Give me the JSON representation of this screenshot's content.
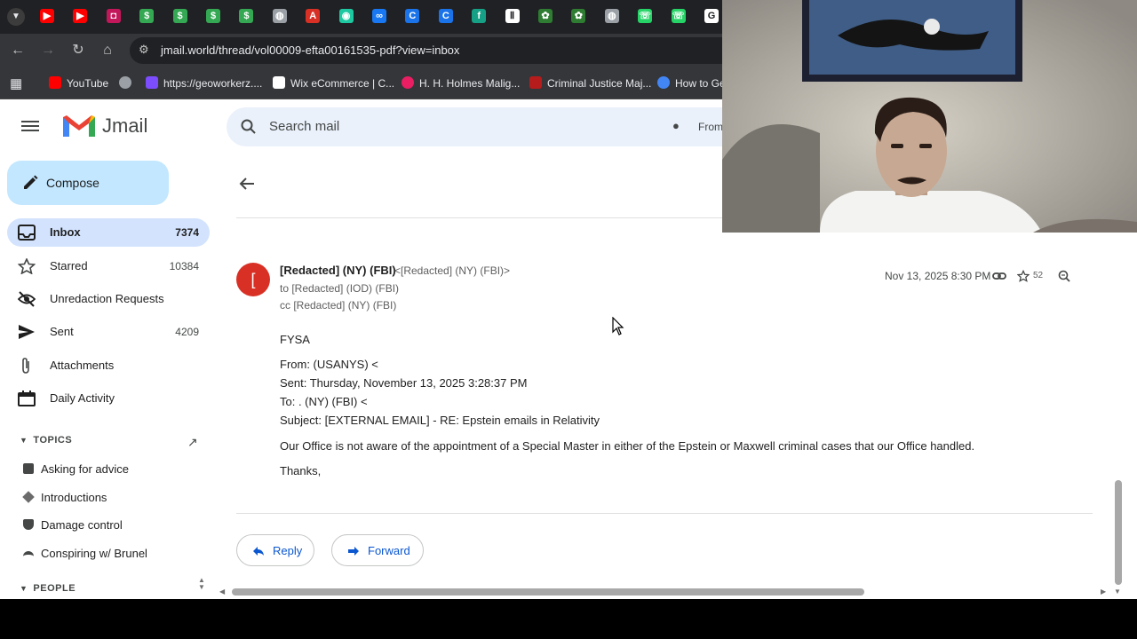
{
  "browser": {
    "url": "jmail.world/thread/vol00009-efta00161535-pdf?view=inbox",
    "tab_icons": [
      {
        "name": "youtube-tab-icon",
        "color": "#ff0000",
        "glyph": "▶"
      },
      {
        "name": "youtube-tab-icon",
        "color": "#ff0000",
        "glyph": "▶"
      },
      {
        "name": "bookmark-tab-icon",
        "color": "#c2185b",
        "glyph": "◘"
      },
      {
        "name": "dollar-tab-icon",
        "color": "#34a853",
        "glyph": "$"
      },
      {
        "name": "dollar-tab-icon",
        "color": "#34a853",
        "glyph": "$"
      },
      {
        "name": "dollar-tab-icon",
        "color": "#34a853",
        "glyph": "$"
      },
      {
        "name": "dollar-tab-icon",
        "color": "#34a853",
        "glyph": "$"
      },
      {
        "name": "globe-tab-icon",
        "color": "#9aa0a6",
        "glyph": "◍"
      },
      {
        "name": "pdf-tab-icon",
        "color": "#d93025",
        "glyph": "A"
      },
      {
        "name": "chat-tab-icon",
        "color": "#1ec8a0",
        "glyph": "◉"
      },
      {
        "name": "meta-tab-icon",
        "color": "#1877f2",
        "glyph": "∞"
      },
      {
        "name": "c-tab-icon",
        "color": "#1a73e8",
        "glyph": "C"
      },
      {
        "name": "c-tab-icon",
        "color": "#1a73e8",
        "glyph": "C"
      },
      {
        "name": "f-tab-icon",
        "color": "#16a085",
        "glyph": "f"
      },
      {
        "name": "active-tab-icon",
        "color": "#ffffff",
        "glyph": "Ⅱ"
      },
      {
        "name": "cactus-tab-icon",
        "color": "#2e7d32",
        "glyph": "✿"
      },
      {
        "name": "cactus-tab-icon",
        "color": "#2e7d32",
        "glyph": "✿"
      },
      {
        "name": "globe-tab-icon",
        "color": "#9aa0a6",
        "glyph": "◍"
      },
      {
        "name": "whatsapp-tab-icon",
        "color": "#25d366",
        "glyph": "☏"
      },
      {
        "name": "whatsapp-tab-icon",
        "color": "#25d366",
        "glyph": "☏"
      },
      {
        "name": "google-tab-icon",
        "color": "#ffffff",
        "glyph": "G"
      }
    ],
    "bookmarks": [
      {
        "label": "YouTube",
        "color": "#ff0000"
      },
      {
        "label": "https://geoworkerz....",
        "color": "#9aa0a6"
      },
      {
        "label": "https://geoworkerz....",
        "color": "#7c4dff"
      },
      {
        "label": "Wix eCommerce | C...",
        "color": "#ffffff"
      },
      {
        "label": "H. H. Holmes Malig...",
        "color": "#e91e63"
      },
      {
        "label": "Criminal Justice Maj...",
        "color": "#b71c1c"
      },
      {
        "label": "How to Ge",
        "color": "#4285f4"
      }
    ]
  },
  "app": {
    "name": "Jmail",
    "search_placeholder": "Search mail",
    "search_filter_label": "From"
  },
  "sidebar": {
    "compose_label": "Compose",
    "items": [
      {
        "label": "Inbox",
        "count": "7374",
        "icon": "inbox-icon",
        "active": true
      },
      {
        "label": "Starred",
        "count": "10384",
        "icon": "star-icon"
      },
      {
        "label": "Unredaction Requests",
        "count": "",
        "icon": "eye-off-icon"
      },
      {
        "label": "Sent",
        "count": "4209",
        "icon": "send-icon"
      },
      {
        "label": "Attachments",
        "count": "",
        "icon": "paperclip-icon"
      },
      {
        "label": "Daily Activity",
        "count": "",
        "icon": "calendar-icon"
      }
    ],
    "topics_header": "TOPICS",
    "topics": [
      {
        "label": "Asking for advice",
        "icon": "chat-bubble-icon"
      },
      {
        "label": "Introductions",
        "icon": "handshake-icon"
      },
      {
        "label": "Damage control",
        "icon": "shield-icon"
      },
      {
        "label": "Conspiring w/ Brunel",
        "icon": "spy-icon"
      }
    ],
    "people_header": "PEOPLE"
  },
  "message": {
    "avatar_letter": "[",
    "sender_name": "[Redacted] (NY) (FBI)",
    "sender_email": "<[Redacted] (NY) (FBI)>",
    "to_line": "to [Redacted] (IOD) (FBI)",
    "cc_line": "cc [Redacted] (NY) (FBI)",
    "date": "Nov 13, 2025 8:30 PM",
    "star_count": "52",
    "body": {
      "greeting": "FYSA",
      "from": "From: (USANYS) <",
      "sent": "Sent: Thursday, November 13, 2025 3:28:37 PM",
      "to": "To: . (NY) (FBI) <",
      "subject": "Subject: [EXTERNAL EMAIL] - RE: Epstein emails in Relativity",
      "text": "Our Office is not aware of the appointment of a Special Master in either of the Epstein or Maxwell criminal cases that our Office handled.",
      "signoff": "Thanks,"
    }
  },
  "actions": {
    "reply_label": "Reply",
    "forward_label": "Forward"
  }
}
